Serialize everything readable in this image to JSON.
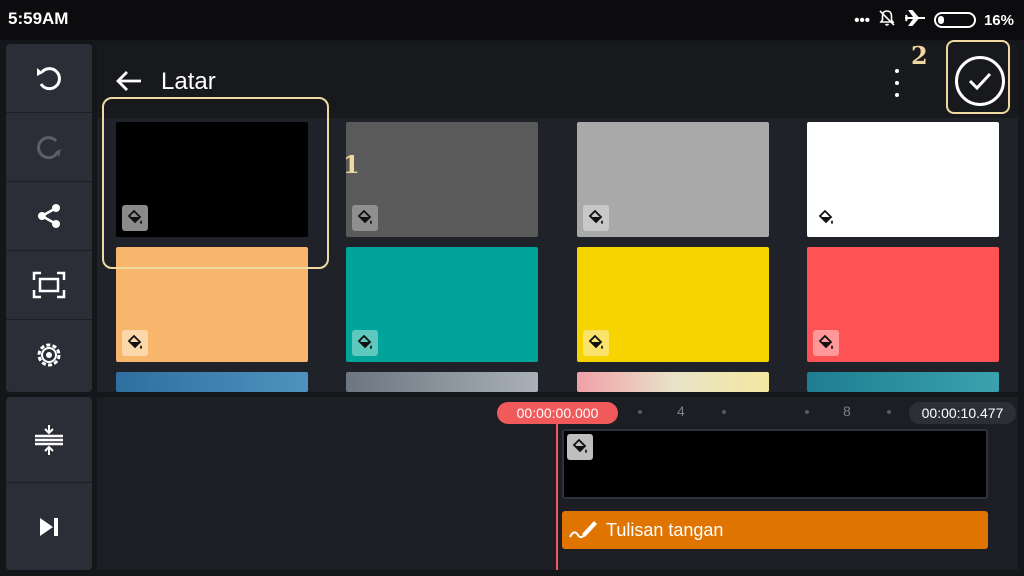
{
  "status_bar": {
    "time": "5:59AM",
    "icons": [
      "more-dots-icon",
      "bell-off-icon",
      "airplane-icon",
      "battery-icon"
    ],
    "battery": "16%"
  },
  "toolbar": {
    "items": [
      {
        "name": "undo",
        "icon": "undo-icon"
      },
      {
        "name": "redo",
        "icon": "redo-icon"
      },
      {
        "name": "share",
        "icon": "share-icon"
      },
      {
        "name": "fullscreen",
        "icon": "fullscreen-icon"
      },
      {
        "name": "settings",
        "icon": "gear-icon"
      }
    ],
    "bottom_items": [
      {
        "name": "split",
        "icon": "split-icon"
      },
      {
        "name": "skip-end",
        "icon": "skip-end-icon"
      }
    ]
  },
  "panel": {
    "title": "Latar",
    "back_icon": "arrow-left-icon",
    "menu_icon": "kebab-icon",
    "confirm_icon": "check-icon"
  },
  "swatches": [
    {
      "color": "#000000",
      "bucket_bg": "#8a8a8a"
    },
    {
      "color": "#5a5a5a",
      "bucket_bg": "#8f8f8f"
    },
    {
      "color": "#a9a9a9",
      "bucket_bg": "#c8c8c8"
    },
    {
      "color": "#ffffff",
      "bucket_bg": "#ffffff"
    },
    {
      "color": "#f8b56c",
      "bucket_bg": "#fbd7a9"
    },
    {
      "color": "#00a49a",
      "bucket_bg": "#5ec8bf"
    },
    {
      "color": "#f7d400",
      "bucket_bg": "#f9e36a"
    },
    {
      "color": "#ff5254",
      "bucket_bg": "#ff9899"
    }
  ],
  "annotations": {
    "one": "1",
    "two": "2"
  },
  "timeline": {
    "current_time": "00:00:00.000",
    "end_time": "00:00:10.477",
    "ticks": [
      "4",
      "8"
    ],
    "layer_label": "Tulisan tangan"
  },
  "colors": {
    "accent_red": "#f15a5a",
    "handwriting_orange": "#e07400",
    "highlight": "#efd9a0"
  }
}
